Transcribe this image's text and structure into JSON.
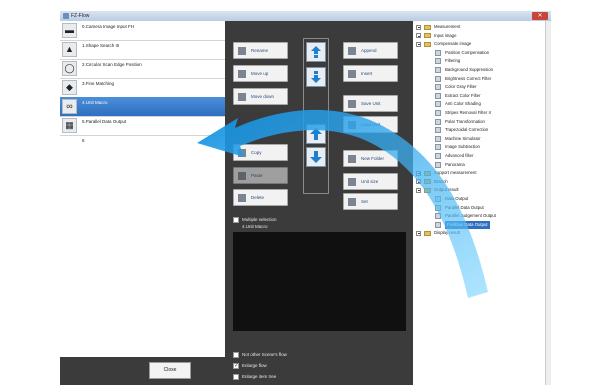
{
  "window": {
    "title": "FZ-Flow"
  },
  "unit_list": [
    {
      "label": "0.Camera Image Input FH",
      "icon": "camera-icon"
    },
    {
      "label": "1.Shape Search III",
      "icon": "shape-search-icon"
    },
    {
      "label": "2.Circular Scan Edge Position",
      "icon": "circle-edge-icon"
    },
    {
      "label": "3.Fine Matching",
      "icon": "fine-matching-icon"
    },
    {
      "label": "4.Unit Macro",
      "icon": "macro-icon",
      "selected": true
    },
    {
      "label": "5.Parallel Data Output",
      "icon": "parallel-output-icon"
    },
    {
      "label": "6",
      "icon": ""
    }
  ],
  "buttons": {
    "rename": "Rename",
    "move_up": "Move up",
    "move_down": "Move down",
    "copy": "Copy",
    "paste": "Paste",
    "delete": "Delete",
    "append": "Append",
    "insert": "Insert",
    "save_unit": "Save Unit",
    "load_unit": "Load Unit",
    "new_folder": "New Folder",
    "unit_size": "Unit size",
    "set": "Set",
    "close": "Close"
  },
  "options": {
    "multiple_selection": "Multiple selection",
    "not_other_scene": "Not other Scene's flow",
    "enlarge_flow": "Enlarge flow",
    "enlarge_item_tree": "Enlarge item tree"
  },
  "preview": {
    "label": "4.Unit Macro"
  },
  "tree": [
    {
      "label": "Measurement",
      "level": 0,
      "kind": "folder"
    },
    {
      "label": "Input image",
      "level": 0,
      "kind": "folder"
    },
    {
      "label": "Compensate image",
      "level": 0,
      "kind": "folder"
    },
    {
      "label": "Position Compensation",
      "level": 1,
      "kind": "leaf"
    },
    {
      "label": "Filtering",
      "level": 1,
      "kind": "leaf"
    },
    {
      "label": "Background Suppression",
      "level": 1,
      "kind": "leaf"
    },
    {
      "label": "Brightness Correct Filter",
      "level": 1,
      "kind": "leaf"
    },
    {
      "label": "Color Gray Filter",
      "level": 1,
      "kind": "leaf"
    },
    {
      "label": "Extract Color Filter",
      "level": 1,
      "kind": "leaf"
    },
    {
      "label": "Anti Color Shading",
      "level": 1,
      "kind": "leaf"
    },
    {
      "label": "Stripes Removal Filter II",
      "level": 1,
      "kind": "leaf"
    },
    {
      "label": "Polar Transformation",
      "level": 1,
      "kind": "leaf"
    },
    {
      "label": "Trapezoidal Correction",
      "level": 1,
      "kind": "leaf"
    },
    {
      "label": "Machine Simulator",
      "level": 1,
      "kind": "leaf"
    },
    {
      "label": "Image Subtraction",
      "level": 1,
      "kind": "leaf"
    },
    {
      "label": "Advanced filter",
      "level": 1,
      "kind": "leaf"
    },
    {
      "label": "Panorama",
      "level": 1,
      "kind": "leaf"
    },
    {
      "label": "Support measurement",
      "level": 0,
      "kind": "folder"
    },
    {
      "label": "Branch",
      "level": 0,
      "kind": "folder"
    },
    {
      "label": "Output result",
      "level": 0,
      "kind": "folder"
    },
    {
      "label": "Data Output",
      "level": 1,
      "kind": "leaf"
    },
    {
      "label": "Parallel Data Output",
      "level": 1,
      "kind": "leaf"
    },
    {
      "label": "Parallel Judgement Output",
      "level": 1,
      "kind": "leaf"
    },
    {
      "label": "Fieldbus Data Output",
      "level": 1,
      "kind": "leaf",
      "selected": true
    },
    {
      "label": "Display result",
      "level": 0,
      "kind": "folder"
    }
  ],
  "colors": {
    "selection": "#2e6fc0",
    "arrow_blue": "#1e9be0",
    "panel_dark": "#3b3b3b"
  }
}
